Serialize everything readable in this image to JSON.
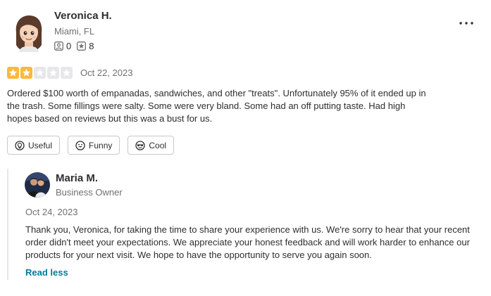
{
  "reviewer": {
    "name": "Veronica H.",
    "location": "Miami, FL",
    "friends_count": "0",
    "reviews_count": "8"
  },
  "review": {
    "rating": 2,
    "max_rating": 5,
    "filled_star_color": "#fcb839",
    "empty_star_color": "#e6e7e8",
    "date": "Oct 22, 2023",
    "text": "Ordered $100 worth of empanadas, sandwiches, and other \"treats\". Unfortunately 95% of it ended up in the trash. Some fillings were salty. Some were very bland. Some had an off putting taste. Had high hopes based on reviews but this was a bust for us."
  },
  "reactions": {
    "useful_label": "Useful",
    "funny_label": "Funny",
    "cool_label": "Cool"
  },
  "owner_reply": {
    "name": "Maria M.",
    "role": "Business Owner",
    "date": "Oct 24, 2023",
    "text": "Thank you, Veronica, for taking the time to share your experience with us. We're sorry to hear that your recent order didn't meet your expectations. We appreciate your honest feedback and will work harder to enhance our products for your next visit. We hope to have the opportunity to serve you again soon.",
    "toggle_label": "Read less"
  },
  "icons": {
    "menu": "more-horizontal-icon",
    "friends": "friends-icon",
    "reviews": "reviews-star-icon",
    "useful": "lightbulb-icon",
    "funny": "smile-icon",
    "cool": "sunglasses-icon"
  }
}
